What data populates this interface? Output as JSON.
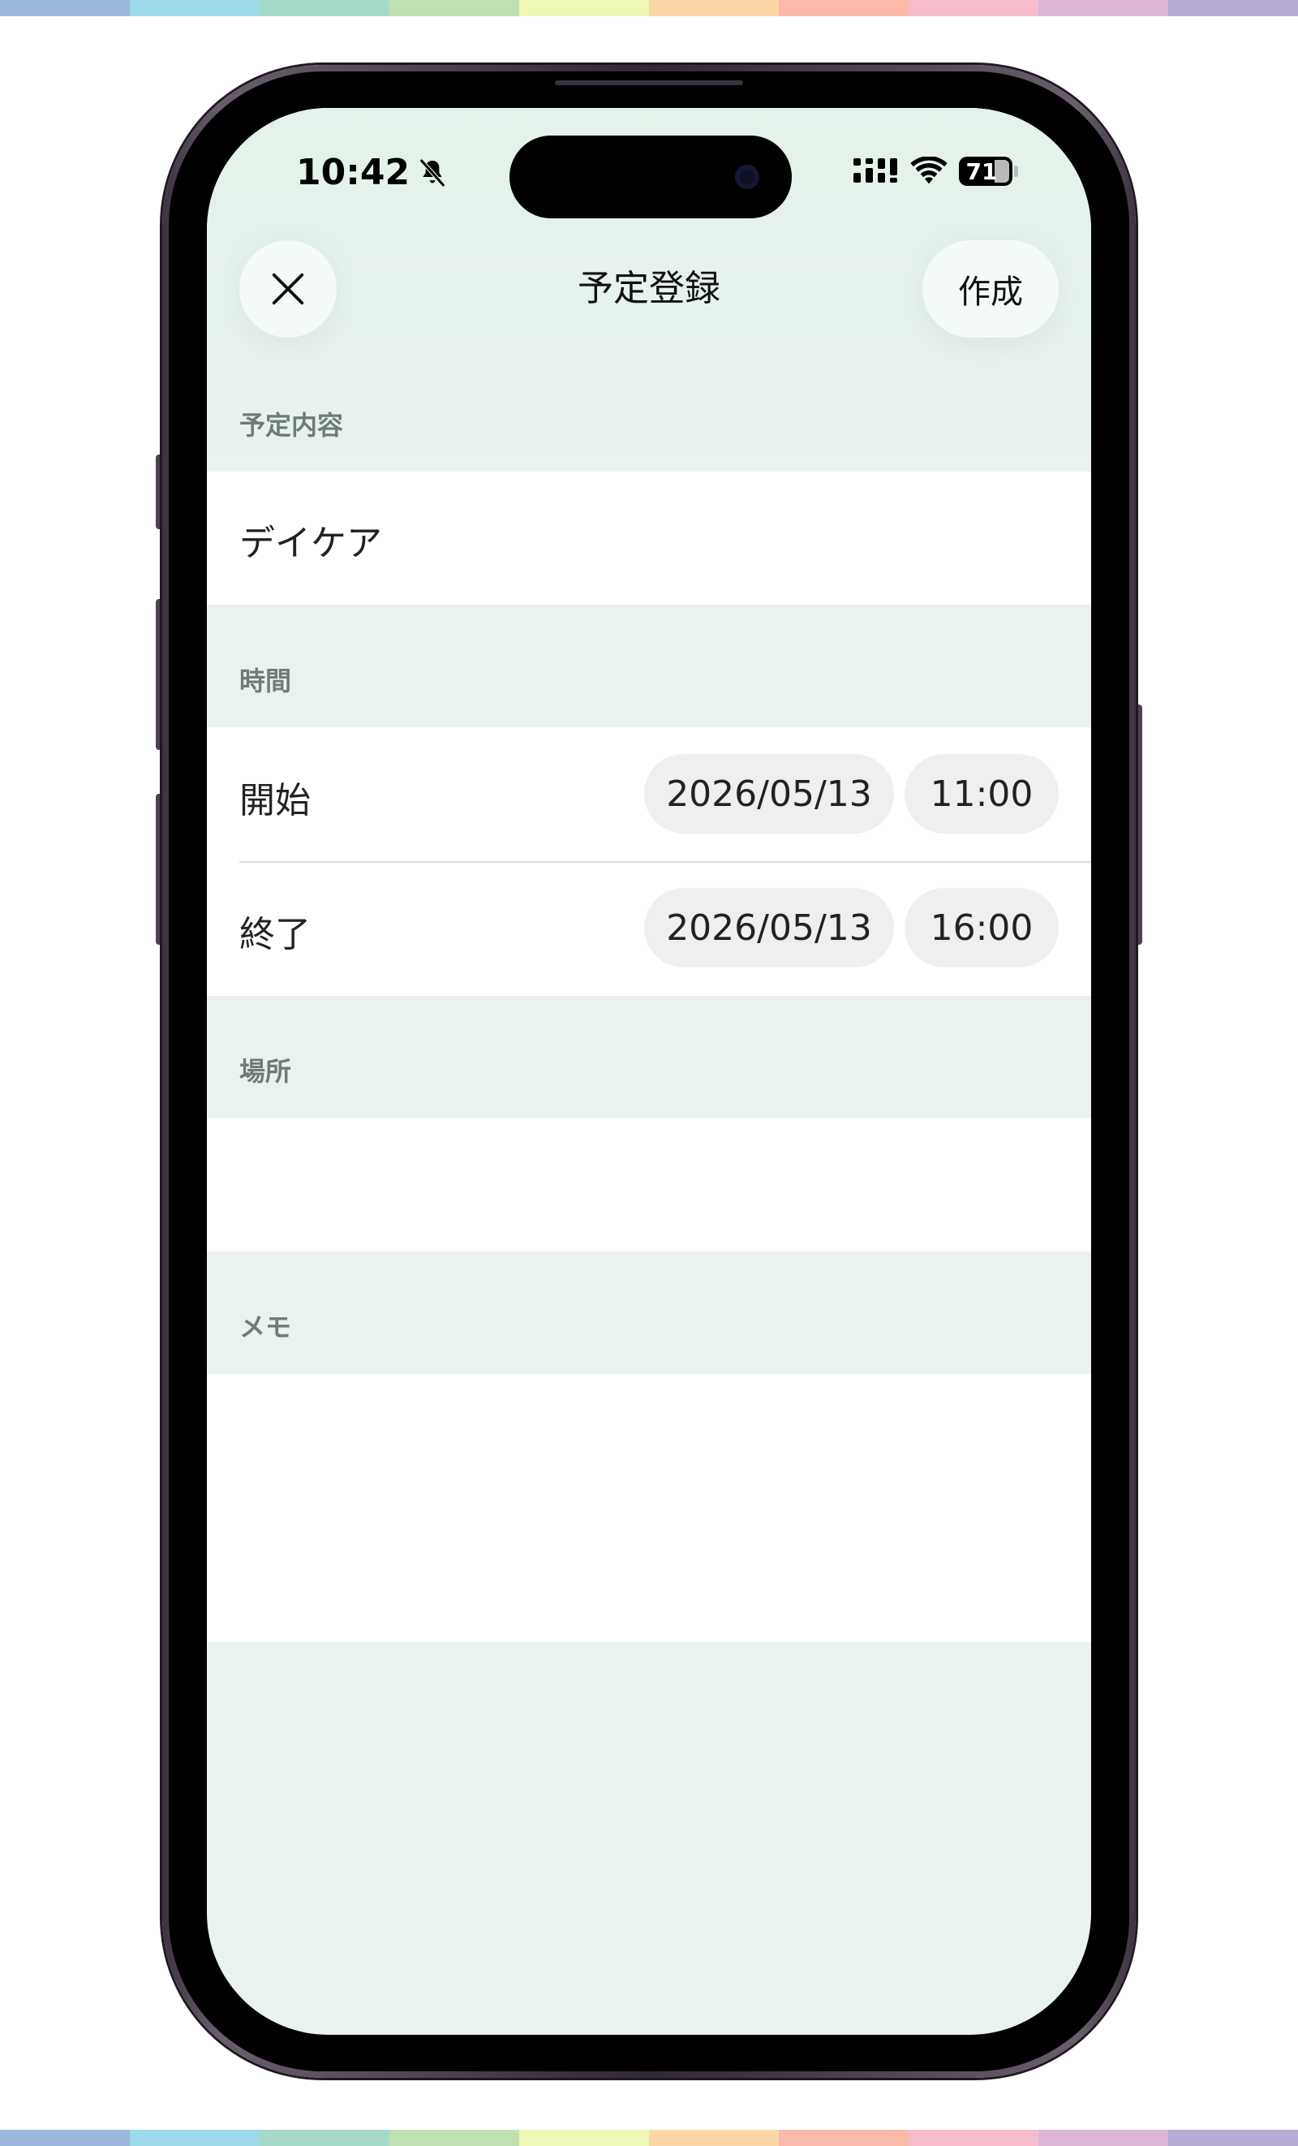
{
  "status_bar": {
    "time": "10:42",
    "battery_level": "71"
  },
  "nav": {
    "title": "予定登録",
    "create_label": "作成"
  },
  "form": {
    "content_label": "予定内容",
    "content_value": "デイケア",
    "time_label": "時間",
    "start_label": "開始",
    "start_date": "2026/05/13",
    "start_time": "11:00",
    "end_label": "終了",
    "end_date": "2026/05/13",
    "end_time": "16:00",
    "location_label": "場所",
    "location_value": "",
    "memo_label": "メモ",
    "memo_value": ""
  },
  "icons": {
    "close": "close-icon",
    "bell_slash": "bell-slash-icon",
    "signal": "cellular-signal-icon",
    "wifi": "wifi-icon",
    "battery": "battery-icon"
  },
  "colors": {
    "background_tint": "#e9f2ed",
    "pill_background": "#efefef",
    "section_label": "#6f7b75"
  }
}
